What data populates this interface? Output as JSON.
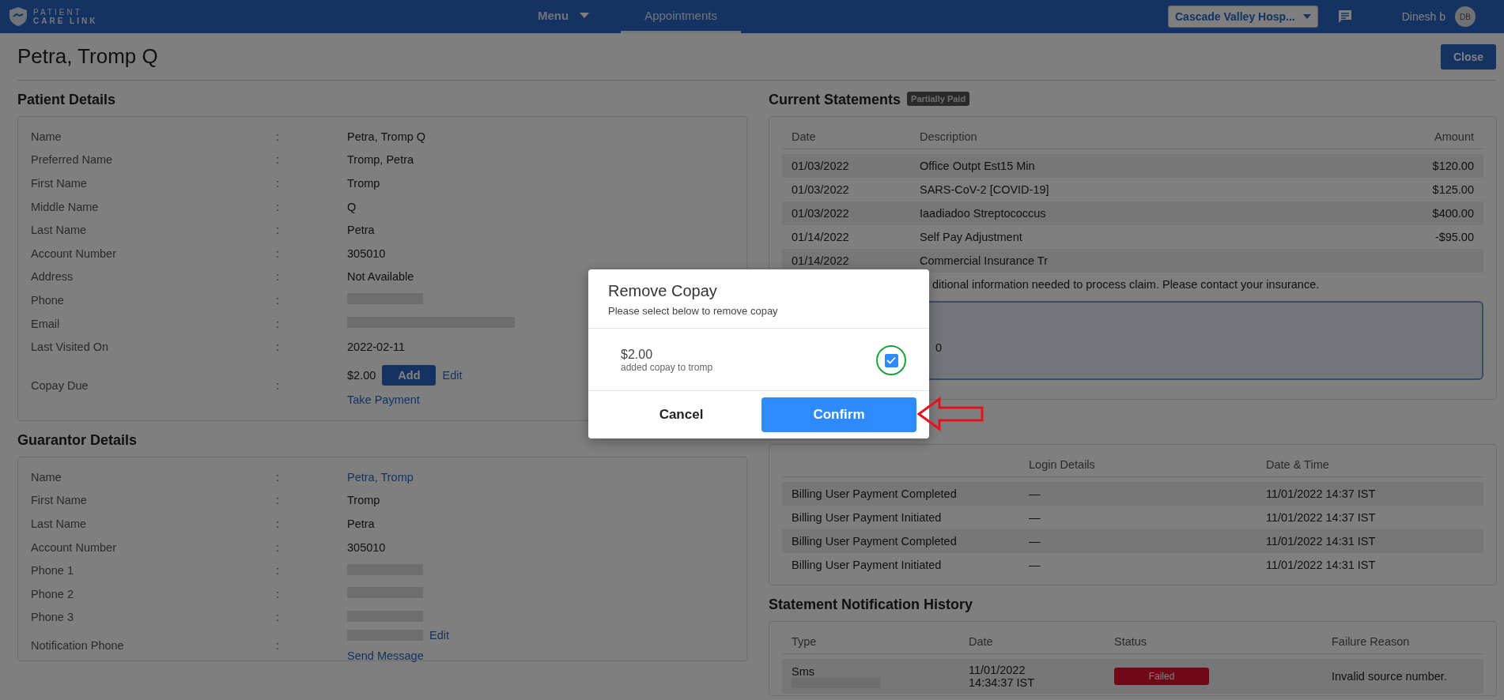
{
  "header": {
    "logo_top": "PATIENT",
    "logo_bottom": "CARE LINK",
    "nav": [
      {
        "label": "Menu",
        "kind": "dropdown",
        "selected": false
      },
      {
        "label": "Appointments",
        "kind": "link",
        "selected": true
      }
    ],
    "facility": "Cascade Valley Hosp...",
    "user": "Dinesh b",
    "avatar": "DB"
  },
  "page": {
    "title": "Petra, Tromp Q",
    "close": "Close"
  },
  "patient": {
    "title": "Patient Details",
    "colon": ":",
    "rows": [
      {
        "label": "Name",
        "kind": "text",
        "value": "Petra, Tromp Q"
      },
      {
        "label": "Preferred Name",
        "kind": "text",
        "value": "Tromp, Petra"
      },
      {
        "label": "First Name",
        "kind": "text",
        "value": "Tromp"
      },
      {
        "label": "Middle Name",
        "kind": "text",
        "value": "Q"
      },
      {
        "label": "Last Name",
        "kind": "text",
        "value": "Petra"
      },
      {
        "label": "Account Number",
        "kind": "text",
        "value": "305010"
      },
      {
        "label": "Address",
        "kind": "text",
        "value": "Not Available"
      },
      {
        "label": "Phone",
        "kind": "redacted"
      },
      {
        "label": "Email",
        "kind": "redacted_long"
      },
      {
        "label": "Last Visited On",
        "kind": "text",
        "value": "2022-02-11"
      },
      {
        "label": "Copay Due",
        "kind": "copay",
        "value": "$2.00",
        "button": "Add",
        "edit": "Edit",
        "action": "Take Payment"
      }
    ]
  },
  "guarantor": {
    "title": "Guarantor Details",
    "colon": ":",
    "rows": [
      {
        "label": "Name",
        "kind": "link",
        "value": "Petra, Tromp"
      },
      {
        "label": "First Name",
        "kind": "text",
        "value": "Tromp"
      },
      {
        "label": "Last Name",
        "kind": "text",
        "value": "Petra"
      },
      {
        "label": "Account Number",
        "kind": "text",
        "value": "305010"
      },
      {
        "label": "Phone 1",
        "kind": "redacted"
      },
      {
        "label": "Phone 2",
        "kind": "redacted"
      },
      {
        "label": "Phone 3",
        "kind": "redacted"
      },
      {
        "label": "Notification Phone",
        "kind": "redacted_edit",
        "edit": "Edit",
        "action": "Send Message"
      }
    ]
  },
  "statements": {
    "title": "Current Statements",
    "badge": "Partially Paid",
    "columns": [
      "Date",
      "Description",
      "Amount"
    ],
    "rows": [
      [
        "01/03/2022",
        "Office Outpt Est15 Min",
        "$120.00"
      ],
      [
        "01/03/2022",
        "SARS-CoV-2 [COVID-19]",
        "$125.00"
      ],
      [
        "01/03/2022",
        "Iaadiadoo Streptococcus",
        "$400.00"
      ],
      [
        "01/14/2022",
        "Self Pay Adjustment",
        "-$95.00"
      ],
      [
        "01/14/2022",
        "Commercial Insurance Tr",
        ""
      ]
    ],
    "note": "ditional information needed to process claim. Please contact your insurance.",
    "box_text": "0"
  },
  "activity": {
    "columns": [
      "",
      "Login Details",
      "Date & Time"
    ],
    "rows": [
      [
        "Billing User Payment Completed",
        "—",
        "11/01/2022 14:37 IST"
      ],
      [
        "Billing User Payment Initiated",
        "—",
        "11/01/2022 14:37 IST"
      ],
      [
        "Billing User Payment Completed",
        "—",
        "11/01/2022 14:31 IST"
      ],
      [
        "Billing User Payment Initiated",
        "—",
        "11/01/2022 14:31 IST"
      ]
    ]
  },
  "notifications": {
    "title": "Statement Notification History",
    "columns": [
      "Type",
      "Date",
      "Status",
      "Failure Reason"
    ],
    "rows": [
      {
        "type": "Sms",
        "date": "11/01/2022",
        "time": "14:34:37 IST",
        "status": "Failed",
        "reason": "Invalid source number."
      }
    ]
  },
  "modal": {
    "title": "Remove Copay",
    "subtitle": "Please select below to remove copay",
    "items": [
      {
        "amount": "$2.00",
        "note": "added copay to tromp",
        "checked": true
      }
    ],
    "cancel": "Cancel",
    "confirm": "Confirm"
  }
}
